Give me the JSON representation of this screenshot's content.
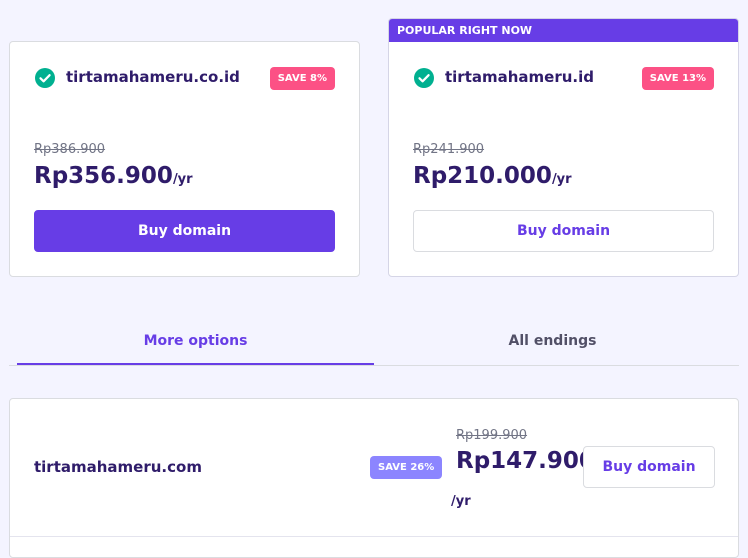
{
  "cards": [
    {
      "domain": "tirtamahameru.co.id",
      "badge": "SAVE 8%",
      "old_price": "Rp386.900",
      "price": "Rp356.900",
      "per": "/yr",
      "button": "Buy domain"
    },
    {
      "ribbon": "POPULAR RIGHT NOW",
      "domain": "tirtamahameru.id",
      "badge": "SAVE 13%",
      "old_price": "Rp241.900",
      "price": "Rp210.000",
      "per": "/yr",
      "button": "Buy domain"
    }
  ],
  "tabs": {
    "more_options": "More options",
    "all_endings": "All endings"
  },
  "list": [
    {
      "domain": "tirtamahameru.com",
      "badge": "SAVE 26%",
      "old_price": "Rp199.900",
      "price": "Rp147.900",
      "per": "/yr",
      "button": "Buy domain"
    }
  ],
  "colors": {
    "accent": "#673de6",
    "save_badge": "#fc5185",
    "save_badge_alt": "#8c85ff",
    "check": "#00b090",
    "text_dark": "#2f1c6a"
  },
  "icons": {
    "available": "check-circle-icon"
  }
}
